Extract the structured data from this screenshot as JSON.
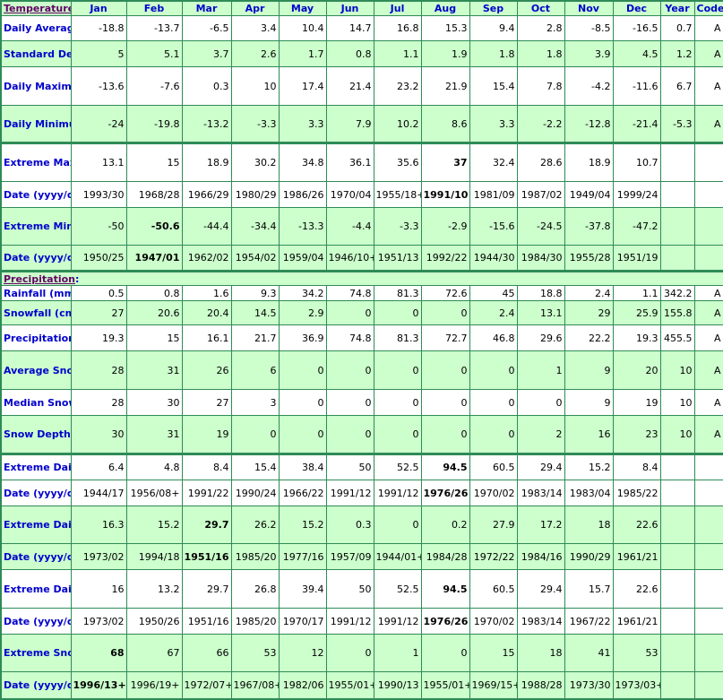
{
  "columns": [
    "Jan",
    "Feb",
    "Mar",
    "Apr",
    "May",
    "Jun",
    "Jul",
    "Aug",
    "Sep",
    "Oct",
    "Nov",
    "Dec",
    "Year",
    "Code"
  ],
  "colors": {
    "header_bg": "#ccffcc",
    "border": "#2e8b57",
    "label_text": "#0000cc",
    "section_link": "#660066"
  },
  "temperature": {
    "section_label": "Temperature",
    "colon": ":",
    "rows": [
      {
        "label": "Daily Average (°C)",
        "bg": "w",
        "values": [
          "-18.8",
          "-13.7",
          "-6.5",
          "3.4",
          "10.4",
          "14.7",
          "16.8",
          "15.3",
          "9.4",
          "2.8",
          "-8.5",
          "-16.5",
          "0.7",
          "A"
        ],
        "bold": []
      },
      {
        "label": "Standard Deviation",
        "bg": "g",
        "values": [
          "5",
          "5.1",
          "3.7",
          "2.6",
          "1.7",
          "0.8",
          "1.1",
          "1.9",
          "1.8",
          "1.8",
          "3.9",
          "4.5",
          "1.2",
          "A"
        ],
        "bold": []
      },
      {
        "label": "Daily Maximum (°C)",
        "bg": "w",
        "values": [
          "-13.6",
          "-7.6",
          "0.3",
          "10",
          "17.4",
          "21.4",
          "23.2",
          "21.9",
          "15.4",
          "7.8",
          "-4.2",
          "-11.6",
          "6.7",
          "A"
        ],
        "bold": []
      },
      {
        "label": "Daily Minimum (°C)",
        "bg": "g",
        "values": [
          "-24",
          "-19.8",
          "-13.2",
          "-3.3",
          "3.3",
          "7.9",
          "10.2",
          "8.6",
          "3.3",
          "-2.2",
          "-12.8",
          "-21.4",
          "-5.3",
          "A"
        ],
        "bold": []
      },
      {
        "label": "Extreme Maximum (°C)",
        "bg": "w",
        "sep": true,
        "values": [
          "13.1",
          "15",
          "18.9",
          "30.2",
          "34.8",
          "36.1",
          "35.6",
          "37",
          "32.4",
          "28.6",
          "18.9",
          "10.7",
          "",
          ""
        ],
        "bold": [
          7
        ]
      },
      {
        "label": "Date (yyyy/dd)",
        "bg": "w",
        "values": [
          "1993/30",
          "1968/28",
          "1966/29",
          "1980/29",
          "1986/26",
          "1970/04",
          "1955/18+",
          "1991/10",
          "1981/09",
          "1987/02",
          "1949/04",
          "1999/24",
          "",
          ""
        ],
        "bold": [
          7
        ]
      },
      {
        "label": "Extreme Minimum (°C)",
        "bg": "g",
        "values": [
          "-50",
          "-50.6",
          "-44.4",
          "-34.4",
          "-13.3",
          "-4.4",
          "-3.3",
          "-2.9",
          "-15.6",
          "-24.5",
          "-37.8",
          "-47.2",
          "",
          ""
        ],
        "bold": [
          1
        ]
      },
      {
        "label": "Date (yyyy/dd)",
        "bg": "g",
        "values": [
          "1950/25",
          "1947/01",
          "1962/02",
          "1954/02",
          "1959/04",
          "1946/10+",
          "1951/13",
          "1992/22",
          "1944/30",
          "1984/30",
          "1955/28",
          "1951/19",
          "",
          ""
        ],
        "bold": [
          1
        ]
      }
    ]
  },
  "precipitation": {
    "section_label": "Precipitation",
    "colon": ":",
    "rows": [
      {
        "label": "Rainfall (mm)",
        "bg": "w",
        "values": [
          "0.5",
          "0.8",
          "1.6",
          "9.3",
          "34.2",
          "74.8",
          "81.3",
          "72.6",
          "45",
          "18.8",
          "2.4",
          "1.1",
          "342.2",
          "A"
        ],
        "bold": []
      },
      {
        "label": "Snowfall (cm)",
        "bg": "g",
        "values": [
          "27",
          "20.6",
          "20.4",
          "14.5",
          "2.9",
          "0",
          "0",
          "0",
          "2.4",
          "13.1",
          "29",
          "25.9",
          "155.8",
          "A"
        ],
        "bold": []
      },
      {
        "label": "Precipitation (mm)",
        "bg": "w",
        "values": [
          "19.3",
          "15",
          "16.1",
          "21.7",
          "36.9",
          "74.8",
          "81.3",
          "72.7",
          "46.8",
          "29.6",
          "22.2",
          "19.3",
          "455.5",
          "A"
        ],
        "bold": []
      },
      {
        "label": "Average Snow Depth (cm)",
        "bg": "g",
        "values": [
          "28",
          "31",
          "26",
          "6",
          "0",
          "0",
          "0",
          "0",
          "0",
          "1",
          "9",
          "20",
          "10",
          "A"
        ],
        "bold": []
      },
      {
        "label": "Median Snow Depth (cm)",
        "bg": "w",
        "values": [
          "28",
          "30",
          "27",
          "3",
          "0",
          "0",
          "0",
          "0",
          "0",
          "0",
          "9",
          "19",
          "10",
          "A"
        ],
        "bold": []
      },
      {
        "label": "Snow Depth at Month-end (cm)",
        "bg": "g",
        "values": [
          "30",
          "31",
          "19",
          "0",
          "0",
          "0",
          "0",
          "0",
          "0",
          "2",
          "16",
          "23",
          "10",
          "A"
        ],
        "bold": []
      },
      {
        "label": "Extreme Daily Rainfall (mm)",
        "bg": "w",
        "sep": true,
        "values": [
          "6.4",
          "4.8",
          "8.4",
          "15.4",
          "38.4",
          "50",
          "52.5",
          "94.5",
          "60.5",
          "29.4",
          "15.2",
          "8.4",
          "",
          ""
        ],
        "bold": [
          7
        ]
      },
      {
        "label": "Date (yyyy/dd)",
        "bg": "w",
        "values": [
          "1944/17",
          "1956/08+",
          "1991/22",
          "1990/24",
          "1966/22",
          "1991/12",
          "1991/12",
          "1976/26",
          "1970/02",
          "1983/14",
          "1983/04",
          "1985/22",
          "",
          ""
        ],
        "bold": [
          7
        ]
      },
      {
        "label": "Extreme Daily Snowfall (cm)",
        "bg": "g",
        "values": [
          "16.3",
          "15.2",
          "29.7",
          "26.2",
          "15.2",
          "0.3",
          "0",
          "0.2",
          "27.9",
          "17.2",
          "18",
          "22.6",
          "",
          ""
        ],
        "bold": [
          2
        ]
      },
      {
        "label": "Date (yyyy/dd)",
        "bg": "g",
        "values": [
          "1973/02",
          "1994/18",
          "1951/16",
          "1985/20",
          "1977/16",
          "1957/09",
          "1944/01+",
          "1984/28",
          "1972/22",
          "1984/16",
          "1990/29",
          "1961/21",
          "",
          ""
        ],
        "bold": [
          2
        ]
      },
      {
        "label": "Extreme Daily Precipitation (mm)",
        "bg": "w",
        "values": [
          "16",
          "13.2",
          "29.7",
          "26.8",
          "39.4",
          "50",
          "52.5",
          "94.5",
          "60.5",
          "29.4",
          "15.7",
          "22.6",
          "",
          ""
        ],
        "bold": [
          7
        ]
      },
      {
        "label": "Date (yyyy/dd)",
        "bg": "w",
        "values": [
          "1973/02",
          "1950/26",
          "1951/16",
          "1985/20",
          "1970/17",
          "1991/12",
          "1991/12",
          "1976/26",
          "1970/02",
          "1983/14",
          "1967/22",
          "1961/21",
          "",
          ""
        ],
        "bold": [
          7
        ]
      },
      {
        "label": "Extreme Snow Depth (cm)",
        "bg": "g",
        "values": [
          "68",
          "67",
          "66",
          "53",
          "12",
          "0",
          "1",
          "0",
          "15",
          "18",
          "41",
          "53",
          "",
          ""
        ],
        "bold": [
          0
        ]
      },
      {
        "label": "Date (yyyy/dd)",
        "bg": "g",
        "values": [
          "1996/13+",
          "1996/19+",
          "1972/07+",
          "1967/08+",
          "1982/06",
          "1955/01+",
          "1990/13",
          "1955/01+",
          "1969/15+",
          "1988/28",
          "1973/30",
          "1973/03+",
          "",
          ""
        ],
        "bold": [
          0
        ]
      }
    ]
  }
}
